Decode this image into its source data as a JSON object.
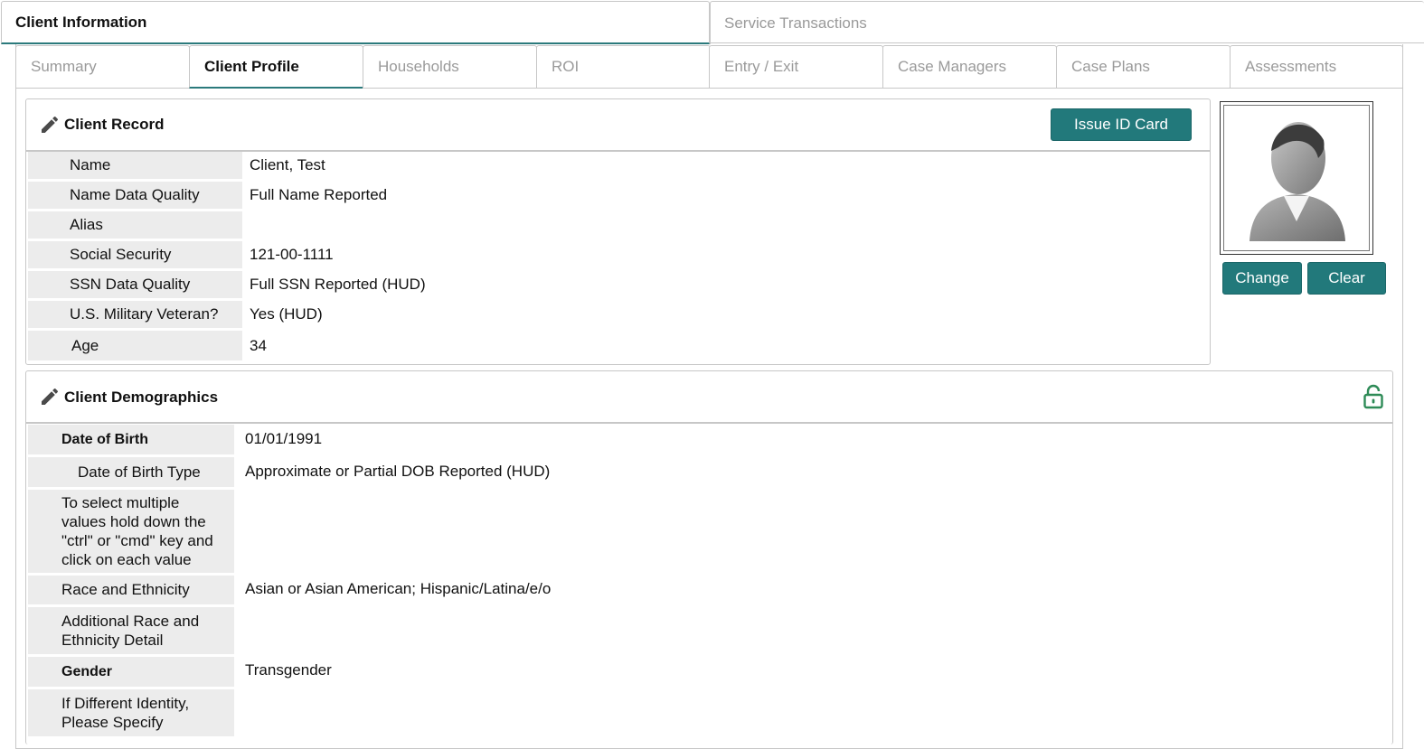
{
  "top_tabs": [
    {
      "label": "Client Information"
    },
    {
      "label": "Service Transactions"
    }
  ],
  "sub_tabs": [
    {
      "label": "Summary"
    },
    {
      "label": "Client Profile"
    },
    {
      "label": "Households"
    },
    {
      "label": "ROI"
    },
    {
      "label": "Entry / Exit"
    },
    {
      "label": "Case Managers"
    },
    {
      "label": "Case Plans"
    },
    {
      "label": "Assessments"
    }
  ],
  "client_record": {
    "title": "Client Record",
    "issue_id_label": "Issue ID Card",
    "rows": [
      {
        "label": "Name",
        "value": "Client, Test"
      },
      {
        "label": "Name Data Quality",
        "value": "Full Name Reported"
      },
      {
        "label": "Alias",
        "value": ""
      },
      {
        "label": "Social Security",
        "value": "121-00-1111"
      },
      {
        "label": "SSN Data Quality",
        "value": "Full SSN Reported (HUD)"
      },
      {
        "label": "U.S. Military Veteran?",
        "value": "Yes (HUD)"
      },
      {
        "label": "Age",
        "value": "34"
      }
    ]
  },
  "photo": {
    "change_label": "Change",
    "clear_label": "Clear"
  },
  "client_demographics": {
    "title": "Client Demographics",
    "rows": [
      {
        "label": "Date of Birth",
        "value": "01/01/1991"
      },
      {
        "label": "Date of Birth Type",
        "value": "Approximate or Partial DOB Reported (HUD)"
      },
      {
        "label": "To select multiple values hold down the \"ctrl\" or \"cmd\" key and click on each value",
        "value": ""
      },
      {
        "label": "Race and Ethnicity",
        "value": "Asian or Asian American; Hispanic/Latina/e/o"
      },
      {
        "label": "Additional Race and Ethnicity Detail",
        "value": ""
      },
      {
        "label": "Gender",
        "value": "Transgender"
      },
      {
        "label": "If Different Identity, Please Specify",
        "value": ""
      }
    ]
  },
  "colors": {
    "accent": "#22797b",
    "lock_green": "#2e8b57",
    "label_bg": "#ececec"
  },
  "icons": [
    "pencil-icon",
    "lock-open-icon",
    "user-avatar-icon"
  ]
}
